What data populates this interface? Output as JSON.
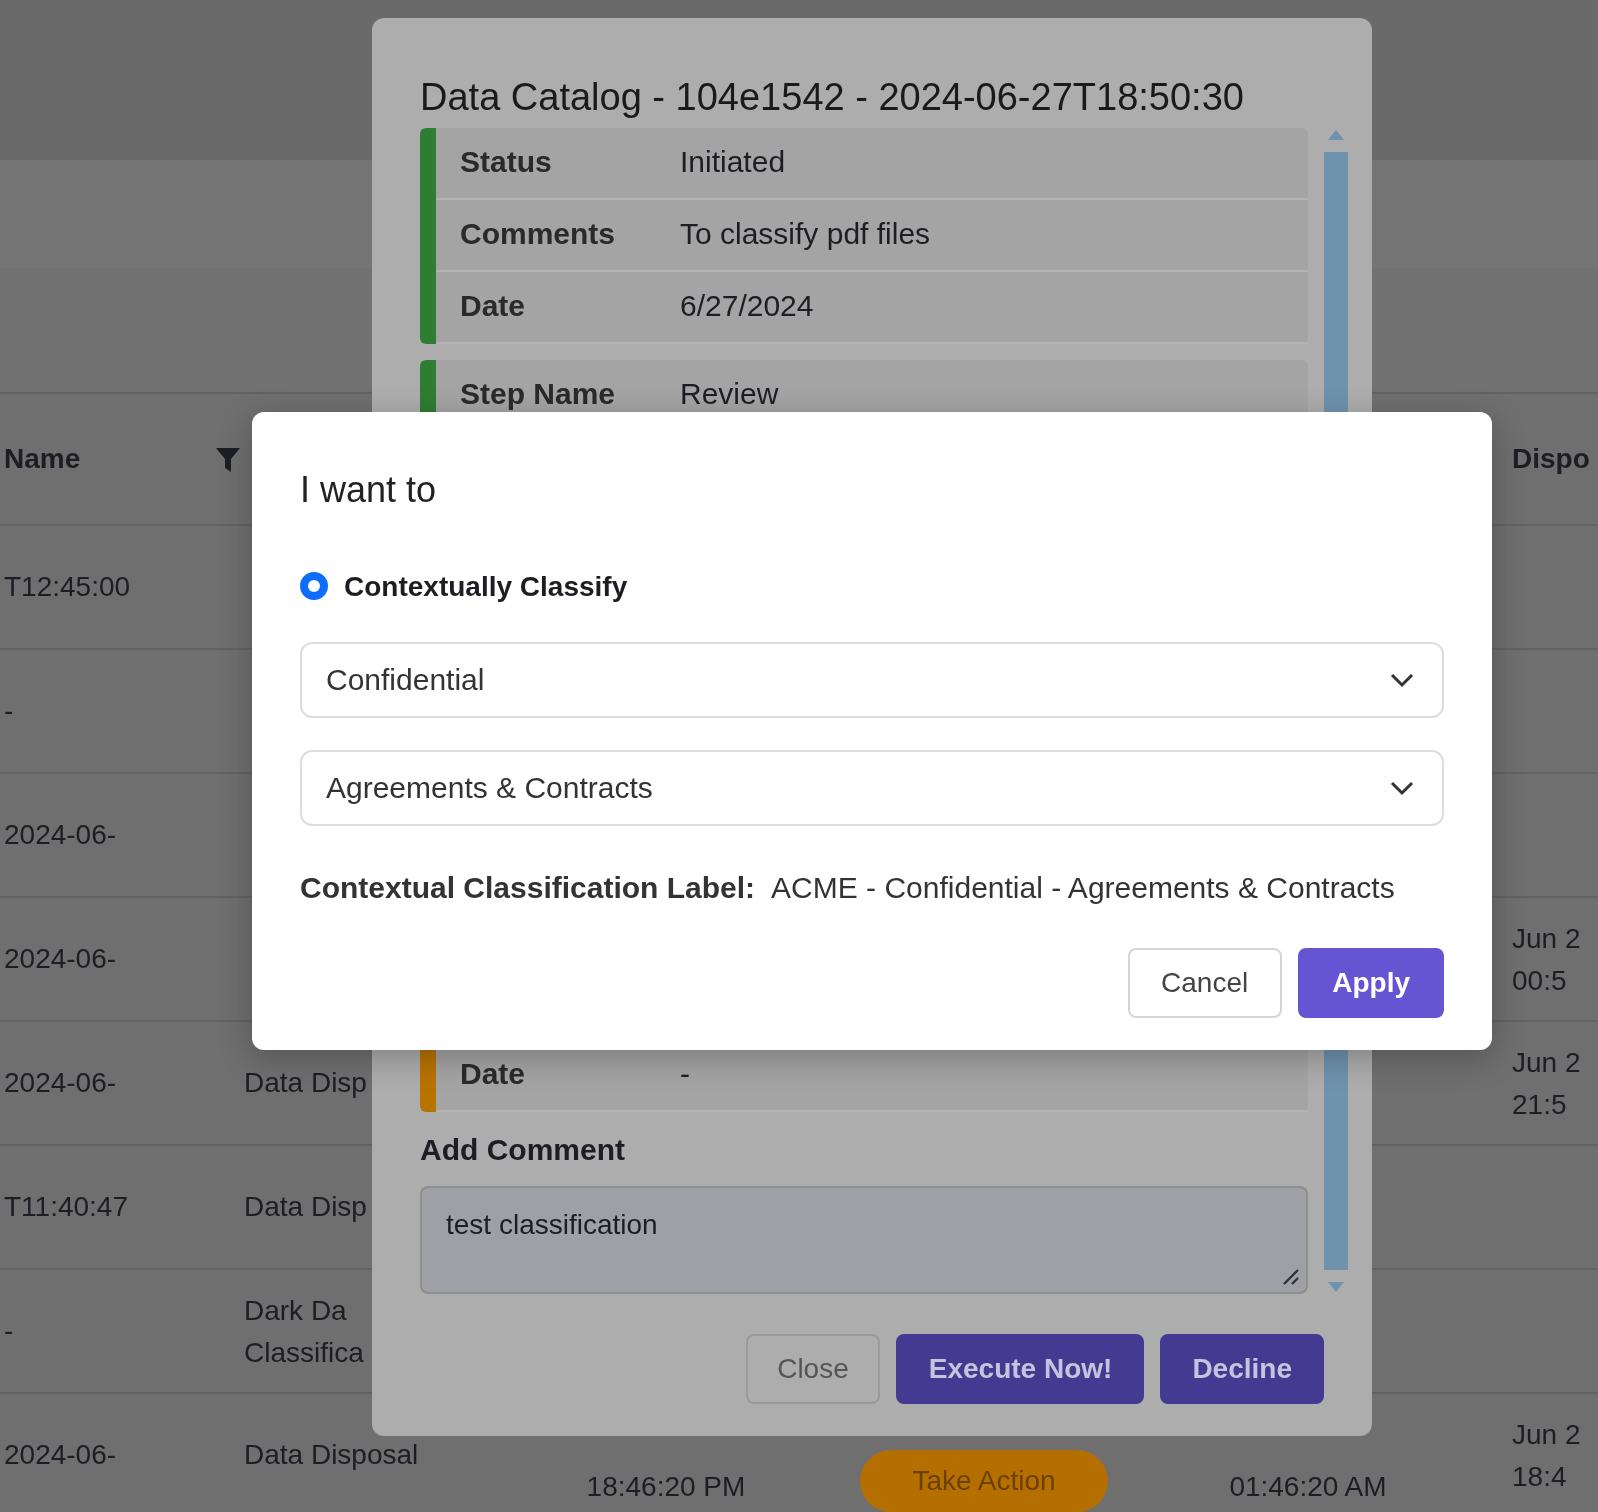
{
  "background_table": {
    "headers": {
      "column_1": "Name",
      "column_6": "Dispo"
    },
    "rows": [
      {
        "column_1": "T12:45:00"
      },
      {
        "column_1": "-"
      },
      {
        "column_1": "2024-06-"
      },
      {
        "column_1": "2024-06-",
        "column_6": "Jun 2\n00:5"
      },
      {
        "column_1": "2024-06-",
        "column_2": "Data Disp",
        "column_6": "Jun 2\n21:5"
      },
      {
        "column_1": "T11:40:47",
        "column_2": "Data Disp"
      },
      {
        "column_1": "-",
        "column_2": "Dark Da\nClassifica"
      },
      {
        "column_1": "2024-06-",
        "column_2": "Data Disposal",
        "column_3": "18:46:20 PM",
        "column_4": "Take Action",
        "column_5": "01:46:20 AM",
        "column_6": "Jun 2\n18:4"
      }
    ]
  },
  "catalog_modal": {
    "title": "Data Catalog - 104e1542 - 2024-06-27T18:50:30",
    "steps": [
      {
        "color": "#2f7d32",
        "fields": [
          {
            "label": "Status",
            "value": "Initiated"
          },
          {
            "label": "Comments",
            "value": "To classify pdf files"
          },
          {
            "label": "Date",
            "value": "6/27/2024"
          }
        ]
      },
      {
        "color": "#2f7d32",
        "fields": [
          {
            "label": "Step Name",
            "value": "Review"
          }
        ]
      },
      {
        "color": "#b87400",
        "fields": [
          {
            "label": "Date",
            "value": "-"
          }
        ]
      }
    ],
    "comment_label": "Add Comment",
    "comment_value": "test classification",
    "buttons": [
      {
        "label": "Close",
        "kind": "secondary"
      },
      {
        "label": "Execute Now!",
        "kind": "primary"
      },
      {
        "label": "Decline",
        "kind": "primary"
      }
    ]
  },
  "classify_dialog": {
    "title": "I want to",
    "option": {
      "label": "Contextually Classify",
      "selected": true
    },
    "selects": [
      {
        "value": "Confidential"
      },
      {
        "value": "Agreements & Contracts"
      }
    ],
    "result": {
      "label": "Contextual Classification Label:",
      "value": "ACME - Confidential - Agreements & Contracts"
    },
    "buttons": [
      {
        "label": "Cancel",
        "kind": "secondary"
      },
      {
        "label": "Apply",
        "kind": "primary"
      }
    ]
  }
}
